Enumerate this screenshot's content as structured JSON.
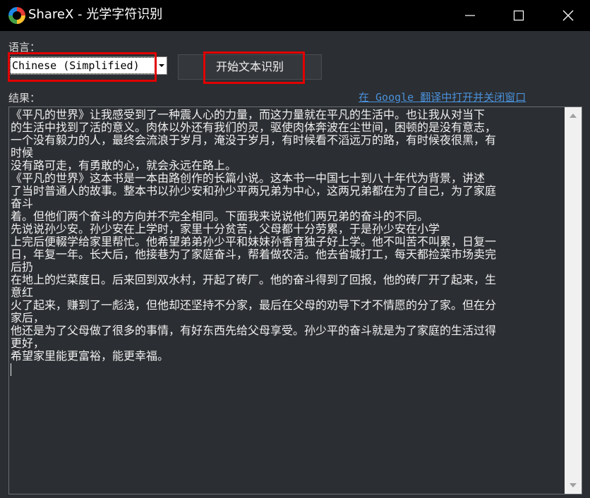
{
  "window": {
    "title": "ShareX - 光学字符识别",
    "icon": "sharex-logo-icon",
    "controls": [
      "minimize-icon",
      "maximize-icon",
      "close-icon"
    ]
  },
  "language": {
    "label": "语言：",
    "selected": "Chinese (Simplified)"
  },
  "start_button": {
    "label": "开始文本识别"
  },
  "result": {
    "label": "结果：",
    "translate_link": "在 Google 翻译中打开并关闭窗口",
    "lines": [
      "《平凡的世界》让我感受到了一种震人心的力量，而这力量就在平凡的生活中。也让我从对当下",
      "的生活中找到了活的意义。肉体以外还有我们的灵，驱使肉体奔波在尘世间，困顿的是没有意志，",
      "一个没有毅力的人，最终会流浪于岁月，淹没于岁月，有时候看不滔远万的路，有时候夜很黑，有",
      "时候",
      "没有路可走，有勇敢的心，就会永远在路上。",
      "《平凡的世界》这本书是一本由路创作的长篇小说。这本书一中国七十到八十年代为背景，讲述",
      "了当时普通人的故事。整本书以孙少安和孙少平两兄弟为中心，这两兄弟都在为了自己，为了家庭",
      "奋斗",
      "着。但他们两个奋斗的方向并不完全相同。下面我来说说他们两兄弟的奋斗的不同。",
      "先说说孙少安。孙少安在上学时，家里十分贫苦，父母都十分劳累，于是孙少安在小学",
      "上完后便輟学给家里帮忙。他希望弟弟孙少平和妹妹孙香育独子好上学。他不叫苦不叫累，日复一",
      "日，年复一年。长大后，他接巷为了家庭奋斗，帮着做农活。他去省城打工，每天都捡菜市场卖完",
      "后扔",
      "在地上的烂菜度日。后来回到双水村，开起了砖厂。他的奋斗得到了回报，他的砖厂开了起来，生",
      "意红",
      "火了起来，赚到了一彪浅，但他却还坚持不分家，最后在父母的劝导下才不情愿的分了家。但在分",
      "家后，",
      "他还是为了父母做了很多的事情，有好东西先给父母享受。孙少平的奋斗就是为了家庭的生活过得",
      "更好，",
      "希望家里能更富裕，能更幸福。"
    ]
  },
  "colors": {
    "background": "#2b2e32",
    "titlebar": "#000000",
    "highlight": "#e00000",
    "link": "#4a90d9"
  }
}
